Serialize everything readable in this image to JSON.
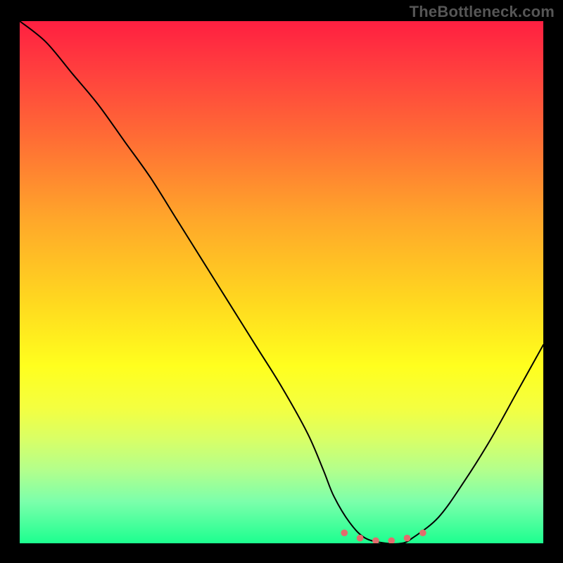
{
  "attribution": "TheBottleneck.com",
  "chart_data": {
    "type": "line",
    "title": "",
    "xlabel": "",
    "ylabel": "",
    "xlim": [
      0,
      100
    ],
    "ylim": [
      0,
      100
    ],
    "series": [
      {
        "name": "bottleneck-curve",
        "x": [
          0,
          5,
          10,
          15,
          20,
          25,
          30,
          35,
          40,
          45,
          50,
          55,
          58,
          60,
          63,
          66,
          70,
          73,
          75,
          80,
          85,
          90,
          95,
          100
        ],
        "values": [
          100,
          96,
          90,
          84,
          77,
          70,
          62,
          54,
          46,
          38,
          30,
          21,
          14,
          9,
          4,
          1,
          0,
          0,
          1,
          5,
          12,
          20,
          29,
          38
        ]
      }
    ],
    "markers": {
      "name": "optimal-range",
      "color": "#e26d6d",
      "points": [
        {
          "x": 62,
          "y": 2
        },
        {
          "x": 65,
          "y": 1
        },
        {
          "x": 68,
          "y": 0.5
        },
        {
          "x": 71,
          "y": 0.5
        },
        {
          "x": 74,
          "y": 1
        },
        {
          "x": 77,
          "y": 2
        }
      ]
    },
    "gradient_stops": [
      {
        "pos": 0,
        "color": "#ff1f41"
      },
      {
        "pos": 10,
        "color": "#ff413e"
      },
      {
        "pos": 22,
        "color": "#ff6b35"
      },
      {
        "pos": 38,
        "color": "#ffa72a"
      },
      {
        "pos": 54,
        "color": "#ffd91f"
      },
      {
        "pos": 66,
        "color": "#ffff1e"
      },
      {
        "pos": 74,
        "color": "#f4ff40"
      },
      {
        "pos": 80,
        "color": "#d9ff66"
      },
      {
        "pos": 86,
        "color": "#b3ff8c"
      },
      {
        "pos": 92,
        "color": "#7cffab"
      },
      {
        "pos": 100,
        "color": "#1cff8f"
      }
    ]
  }
}
